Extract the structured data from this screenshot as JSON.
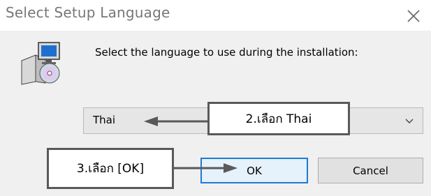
{
  "window": {
    "title": "Select Setup Language",
    "close_icon": "close-icon"
  },
  "dialog": {
    "icon": "setup-installer-icon",
    "prompt": "Select the language to use during the installation:",
    "language_select": {
      "value": "Thai",
      "icon": "chevron-down-icon"
    },
    "buttons": {
      "ok": "OK",
      "cancel": "Cancel"
    }
  },
  "annotations": {
    "select_callout": "2.เลือก Thai",
    "ok_callout": "3.เลือก [OK]",
    "arrow_color": "#595959"
  },
  "colors": {
    "accent": "#1e7ad2",
    "dialog_bg": "#f0f0f0",
    "title_text": "#777777"
  }
}
